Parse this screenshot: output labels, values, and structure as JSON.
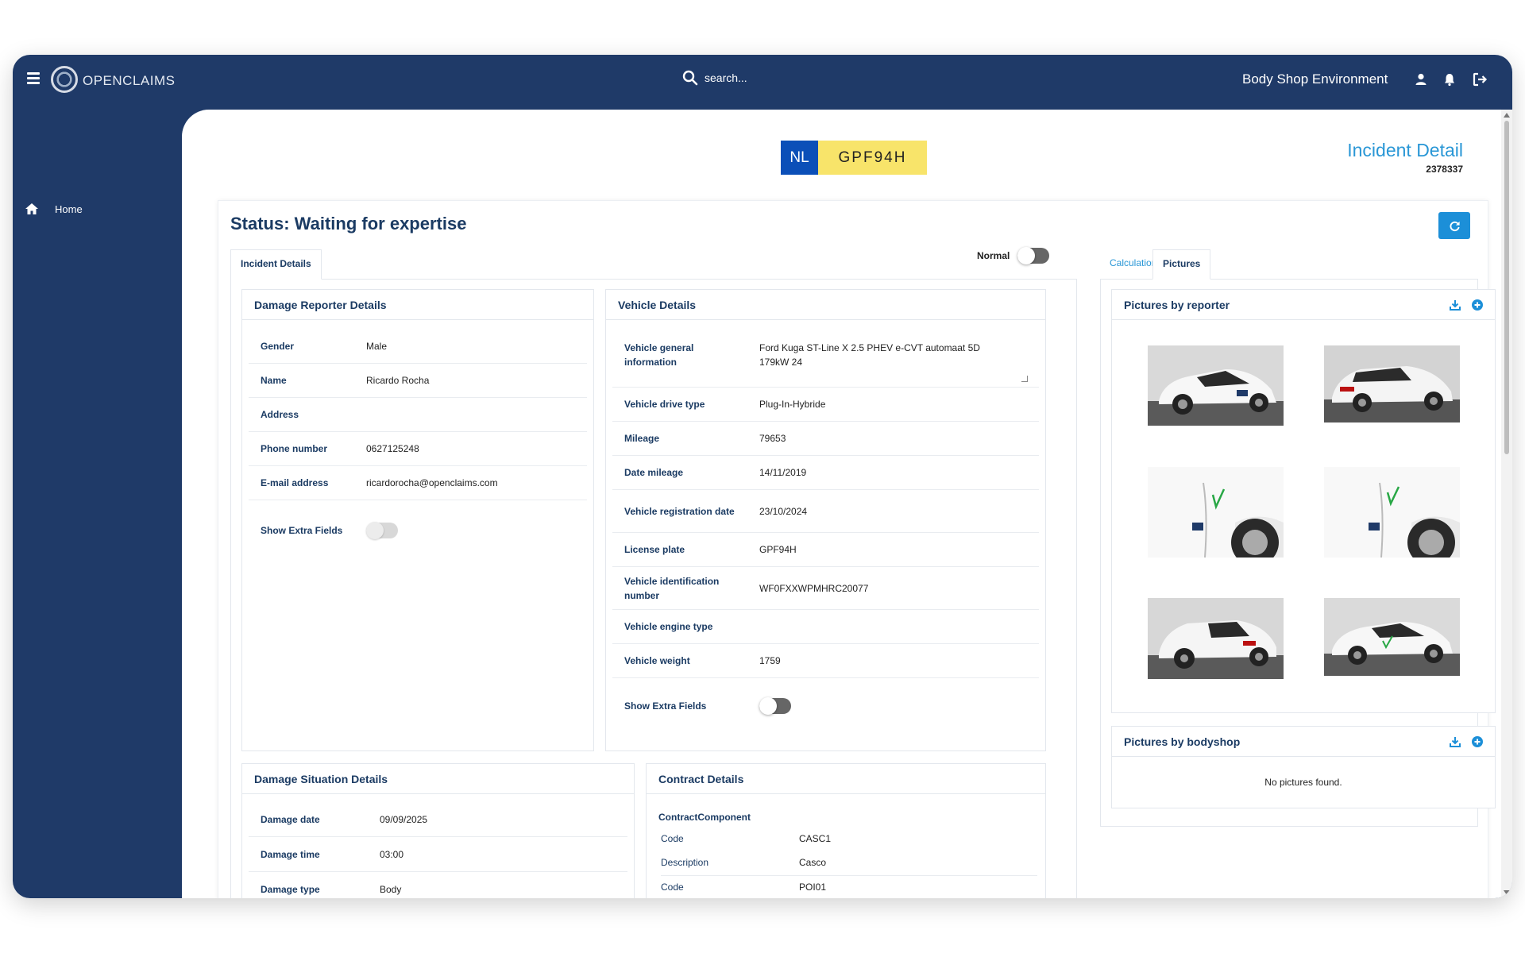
{
  "app": {
    "name": "OPENCLAIMS",
    "environment": "Body Shop Environment"
  },
  "search": {
    "placeholder": "search..."
  },
  "sidebar": {
    "items": [
      {
        "label": "Home",
        "icon": "home-icon"
      }
    ]
  },
  "plate": {
    "country": "NL",
    "number": "GPF94H"
  },
  "incident": {
    "title": "Incident Detail",
    "id": "2378337"
  },
  "status": {
    "text": "Status: Waiting for expertise"
  },
  "tabs": {
    "left": [
      {
        "label": "Incident Details",
        "active": true
      }
    ],
    "right": [
      {
        "label": "Calculations",
        "active": false
      },
      {
        "label": "Pictures",
        "active": true
      }
    ]
  },
  "mode_toggle": {
    "label": "Normal",
    "on": true
  },
  "reporter": {
    "title": "Damage Reporter Details",
    "rows": [
      {
        "label": "Gender",
        "value": "Male"
      },
      {
        "label": "Name",
        "value": "Ricardo Rocha"
      },
      {
        "label": "Address",
        "value": ""
      },
      {
        "label": "Phone number",
        "value": "0627125248"
      },
      {
        "label": "E-mail address",
        "value": "ricardorocha@openclaims.com"
      }
    ],
    "extra_label": "Show Extra Fields",
    "extra_on": false
  },
  "vehicle": {
    "title": "Vehicle Details",
    "rows": [
      {
        "label": "Vehicle general information",
        "value": "Ford Kuga ST-Line X 2.5 PHEV e-CVT automaat 5D 179kW 24"
      },
      {
        "label": "Vehicle drive type",
        "value": "Plug-In-Hybride"
      },
      {
        "label": "Mileage",
        "value": "79653"
      },
      {
        "label": "Date mileage",
        "value": "14/11/2019"
      },
      {
        "label": "Vehicle registration date",
        "value": "23/10/2024"
      },
      {
        "label": "License plate",
        "value": "GPF94H"
      },
      {
        "label": "Vehicle identification number",
        "value": "WF0FXXWPMHRC20077"
      },
      {
        "label": "Vehicle engine type",
        "value": ""
      },
      {
        "label": "Vehicle weight",
        "value": "1759"
      }
    ],
    "extra_label": "Show Extra Fields",
    "extra_on": true
  },
  "situation": {
    "title": "Damage Situation Details",
    "rows": [
      {
        "label": "Damage date",
        "value": "09/09/2025"
      },
      {
        "label": "Damage time",
        "value": "03:00"
      },
      {
        "label": "Damage type",
        "value": "Body"
      }
    ]
  },
  "contract": {
    "title": "Contract Details",
    "component_title": "ContractComponent",
    "rows": [
      {
        "label": "Code",
        "value": "CASC1"
      },
      {
        "label": "Description",
        "value": "Casco"
      },
      {
        "label": "Code",
        "value": "POI01"
      }
    ]
  },
  "pictures_reporter": {
    "title": "Pictures by reporter",
    "images": [
      {
        "icon": "car-front-photo"
      },
      {
        "icon": "car-rear-photo"
      },
      {
        "icon": "car-door-damage-photo"
      },
      {
        "icon": "car-door-damage-photo"
      },
      {
        "icon": "car-rear-photo"
      },
      {
        "icon": "car-front-photo"
      }
    ]
  },
  "pictures_bodyshop": {
    "title": "Pictures by bodyshop",
    "empty_text": "No pictures found."
  },
  "colors": {
    "navy": "#1f3a68",
    "accent": "#1c8fd8",
    "label": "#1b3b63",
    "plate_blue": "#0b4fb8",
    "plate_yellow": "#f8e46a"
  }
}
